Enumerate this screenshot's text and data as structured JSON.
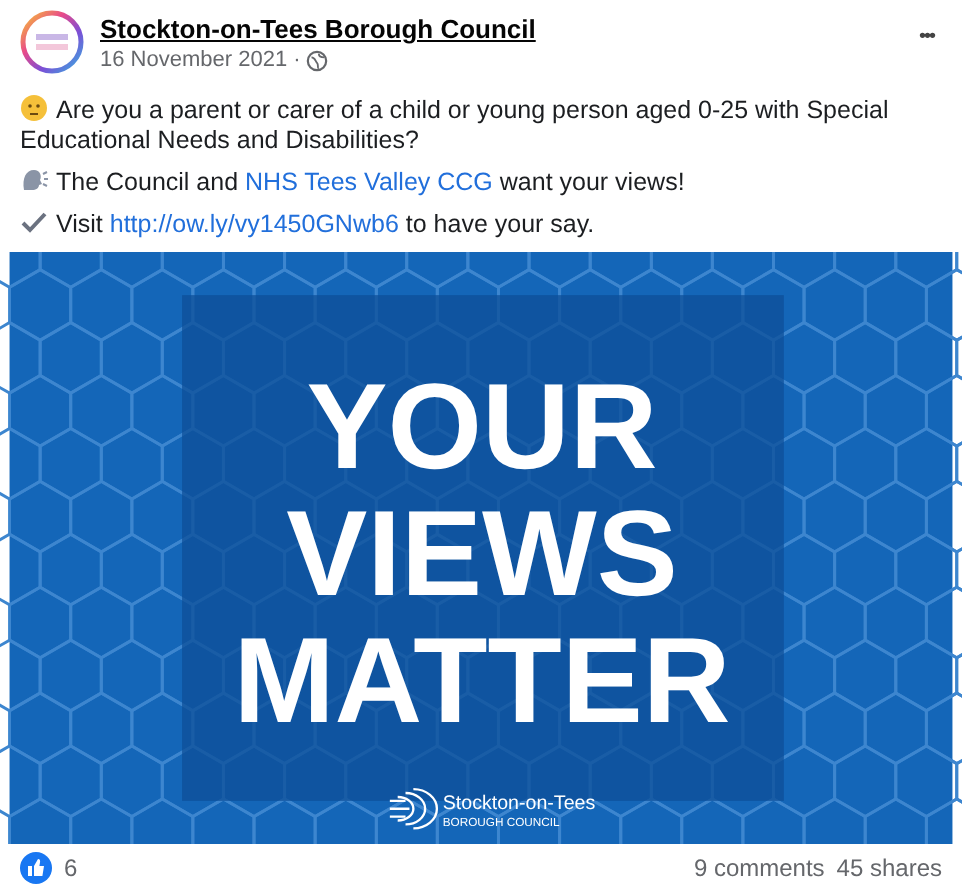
{
  "post": {
    "author": "Stockton-on-Tees Borough Council",
    "date": "16 November 2021",
    "separator": "·",
    "more": "•••",
    "paragraphs": [
      {
        "kind": "question",
        "before": "Are you a parent or carer of a child or young person aged 0-25 with Special Educational Needs and Disabilities?"
      },
      {
        "kind": "announcement",
        "before": "The Council and",
        "link": "NHS Tees Valley CCG",
        "after": "want your views!"
      },
      {
        "kind": "instruction",
        "before": "Visit",
        "link": "http://ow.ly/vy1450GNwb6",
        "after": "to have your say."
      }
    ],
    "graphic": {
      "headline": [
        "YOUR",
        "VIEWS",
        "MATTER"
      ],
      "logo_name": "Stockton-on-Tees",
      "logo_sub": "BOROUGH COUNCIL"
    },
    "reactions": {
      "count": "6"
    },
    "comments": "9 comments",
    "shares": "45 shares"
  }
}
